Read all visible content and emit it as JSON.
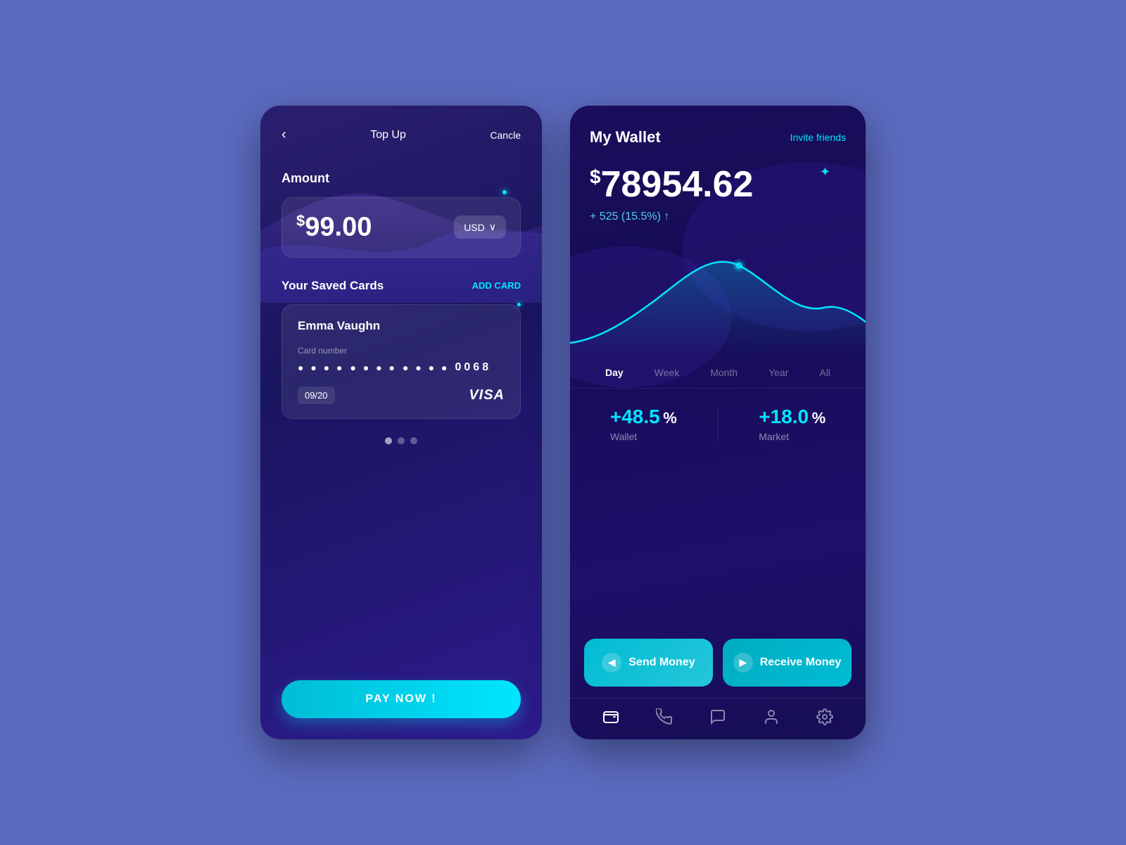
{
  "background": "#5c6bc0",
  "leftPanel": {
    "header": {
      "back": "‹",
      "title": "Top Up",
      "cancel": "Cancle"
    },
    "amountLabel": "Amount",
    "amountValue": "99.00",
    "amountCurrency": "USD",
    "savedCardsLabel": "Your Saved Cards",
    "addCardLabel": "ADD CARD",
    "card": {
      "holderName": "Emma Vaughn",
      "numberLabel": "Card number",
      "dotsGroup1": "● ● ● ●",
      "dotsGroup2": "● ● ● ●",
      "dotsGroup3": "● ● ● ●",
      "last4": "0068",
      "expiry": "09/20",
      "brand": "VISA"
    },
    "payNowLabel": "PAY NOW !"
  },
  "rightPanel": {
    "title": "My Wallet",
    "inviteFriends": "Invite friends",
    "balance": "78954.62",
    "balanceChange": "+ 525 (15.5%) ↑",
    "timeTabs": [
      "Day",
      "Week",
      "Month",
      "Year",
      "All"
    ],
    "activeTab": "Day",
    "stats": [
      {
        "value": "+48.5",
        "pct": "%",
        "label": "Wallet"
      },
      {
        "value": "+18.0",
        "pct": "%",
        "label": "Market"
      }
    ],
    "actions": [
      {
        "icon": "◀",
        "label": "Send Money"
      },
      {
        "icon": "▶",
        "label": "Receive Money"
      }
    ],
    "navIcons": [
      "wallet",
      "phone",
      "chat",
      "person",
      "settings"
    ]
  }
}
